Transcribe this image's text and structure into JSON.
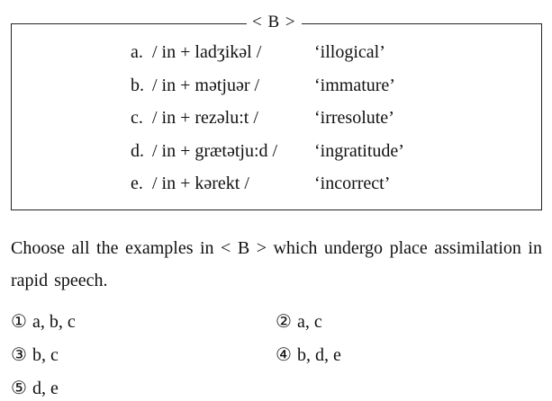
{
  "box": {
    "label": "< B >"
  },
  "examples": [
    {
      "letter": "a.",
      "transcription": "/ in + ladʒikəl /",
      "gloss": "‘illogical’"
    },
    {
      "letter": "b.",
      "transcription": "/ in + mətjuər /",
      "gloss": "‘immature’"
    },
    {
      "letter": "c.",
      "transcription": "/ in + rezəlu:t /",
      "gloss": "‘irresolute’"
    },
    {
      "letter": "d.",
      "transcription": "/ in + grætətju:d /",
      "gloss": "‘ingratitude’"
    },
    {
      "letter": "e.",
      "transcription": "/ in + kərekt /",
      "gloss": "‘incorrect’"
    }
  ],
  "question": "Choose all the examples in < B > which undergo place assimilation in rapid speech.",
  "options": [
    {
      "number": "①",
      "text": "a, b, c"
    },
    {
      "number": "②",
      "text": "a, c"
    },
    {
      "number": "③",
      "text": "b, c"
    },
    {
      "number": "④",
      "text": "b, d, e"
    },
    {
      "number": "⑤",
      "text": "d, e"
    }
  ]
}
